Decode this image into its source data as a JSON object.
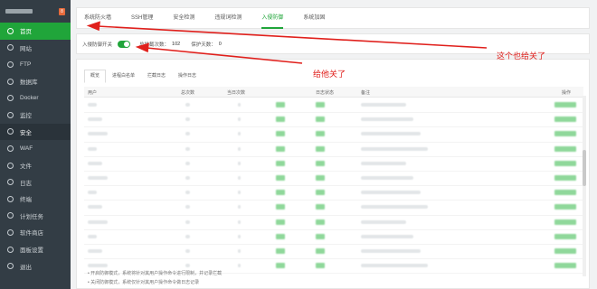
{
  "sidebar": {
    "items": [
      {
        "label": "首页",
        "icon": "home-icon"
      },
      {
        "label": "网站",
        "icon": "globe-icon"
      },
      {
        "label": "FTP",
        "icon": "ftp-icon"
      },
      {
        "label": "数据库",
        "icon": "database-icon"
      },
      {
        "label": "Docker",
        "icon": "docker-icon"
      },
      {
        "label": "监控",
        "icon": "monitor-icon"
      },
      {
        "label": "安全",
        "icon": "shield-icon"
      },
      {
        "label": "WAF",
        "icon": "waf-icon"
      },
      {
        "label": "文件",
        "icon": "folder-icon"
      },
      {
        "label": "日志",
        "icon": "log-icon"
      },
      {
        "label": "终端",
        "icon": "terminal-icon"
      },
      {
        "label": "计划任务",
        "icon": "clock-icon"
      },
      {
        "label": "软件商店",
        "icon": "store-icon"
      },
      {
        "label": "面板设置",
        "icon": "settings-icon"
      },
      {
        "label": "退出",
        "icon": "logout-icon"
      }
    ]
  },
  "tabs": [
    "系统防火墙",
    "SSH管理",
    "安全检测",
    "违规词检测",
    "入侵防御",
    "系统加固"
  ],
  "switch_row": {
    "label": "入侵防御开关",
    "intercept_label": "总拦截次数：",
    "intercept_value": "102",
    "protect_label": "保护天数：",
    "protect_value": "0"
  },
  "subtabs": [
    "概览",
    "进程白名单",
    "拦截日志",
    "操作日志"
  ],
  "table": {
    "columns": [
      "用户",
      "总次数",
      "当日次数",
      "",
      "日志状态",
      "备注",
      "操作"
    ]
  },
  "notes": [
    "开启防御模式，系统将针对其用户操作命令进行限制，并记录拦截",
    "关闭防御模式，系统仅针对其用户操作命令做日志记录"
  ],
  "annotations": {
    "top": "这个也给关了",
    "bottom": "给他关了",
    "color": "#e0201c"
  },
  "colors": {
    "accent": "#20a53a",
    "sidebar": "#333d45"
  }
}
